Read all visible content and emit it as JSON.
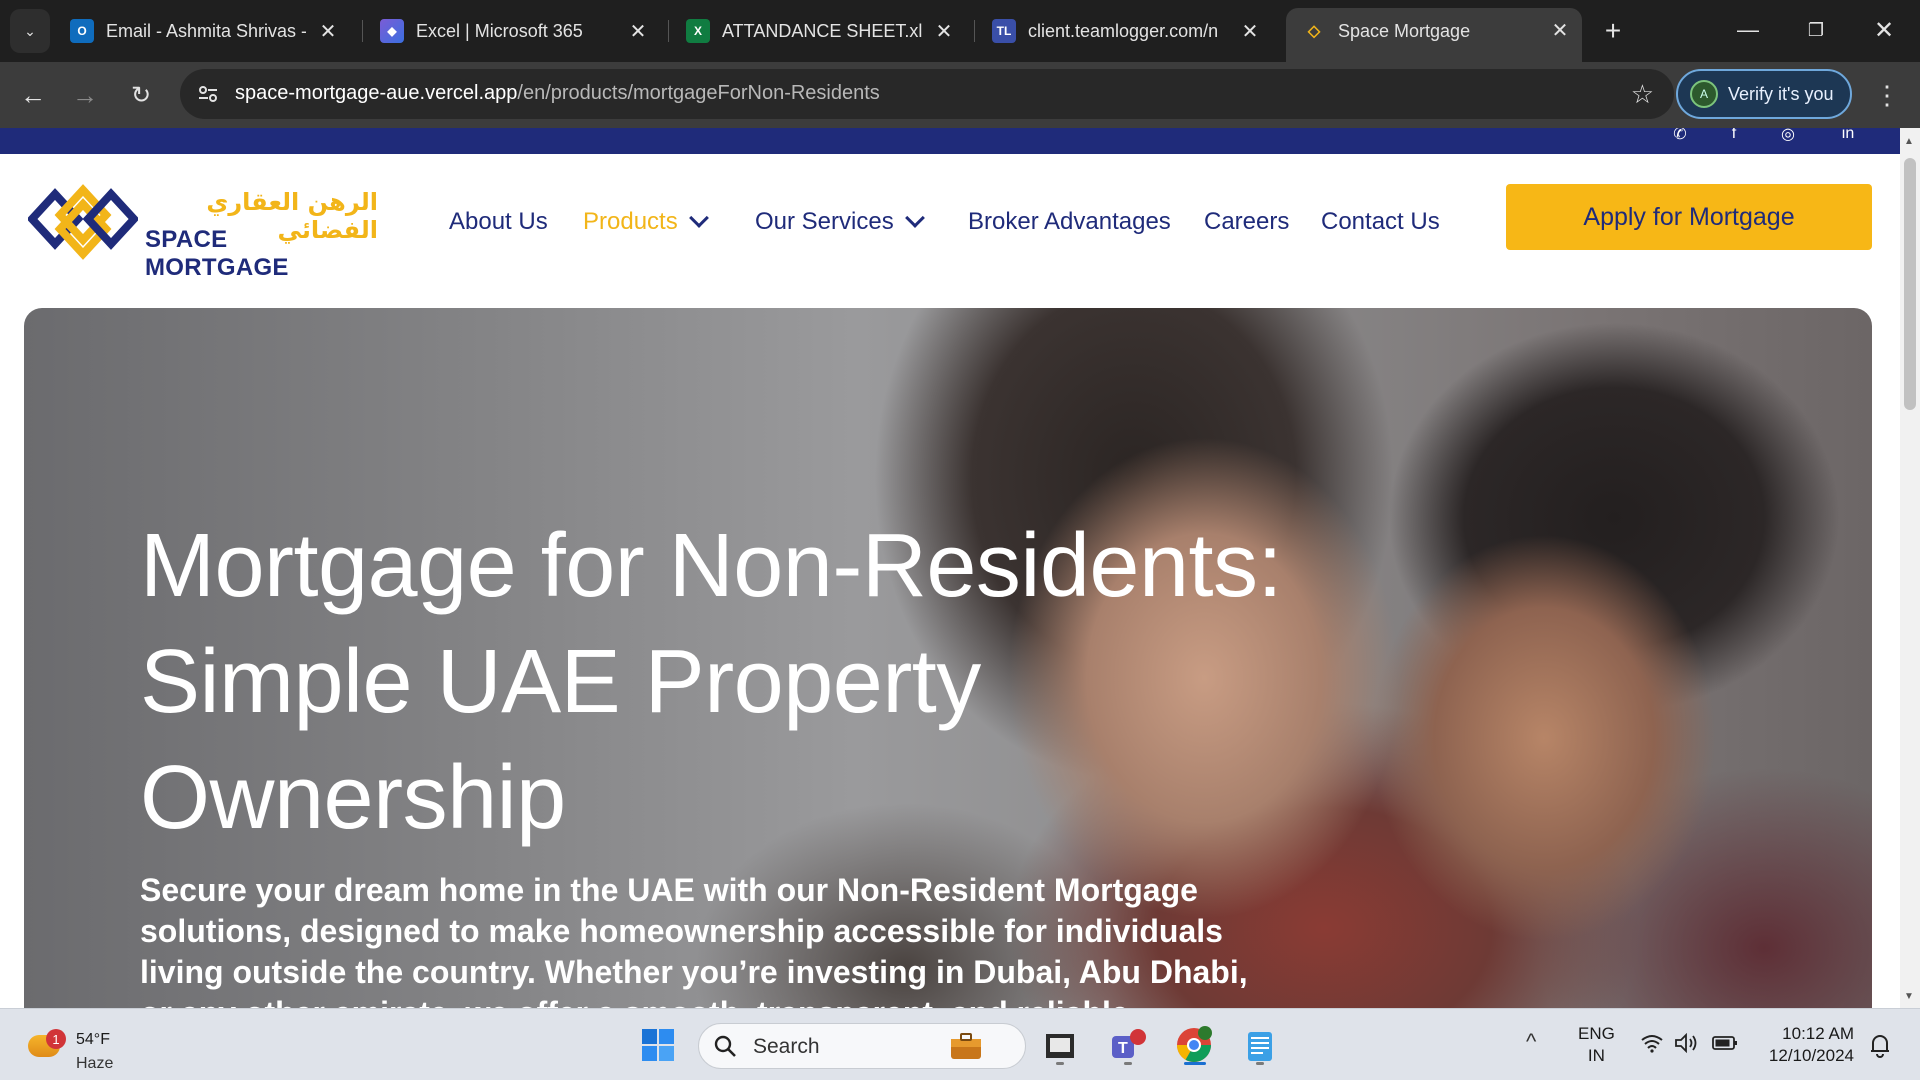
{
  "browser": {
    "tabs": [
      {
        "title": "Email - Ashmita Shrivas -",
        "icon": "outlook-icon",
        "active": false
      },
      {
        "title": "Excel | Microsoft 365",
        "icon": "m365-icon",
        "active": false
      },
      {
        "title": "ATTANDANCE SHEET.xlsx",
        "icon": "excel-icon",
        "active": false
      },
      {
        "title": "client.teamlogger.com/n",
        "icon": "teamlogger-icon",
        "active": false
      },
      {
        "title": "Space Mortgage",
        "icon": "space-mortgage-favicon",
        "active": true
      }
    ],
    "url_host": "space-mortgage-aue.vercel.app",
    "url_path": "/en/products/mortgageForNon-Residents",
    "verify_label": "Verify it's you",
    "profile_initial": "A"
  },
  "site": {
    "logo_arabic": "الرهن العقاري الفضائي",
    "logo_english": "SPACE MORTGAGE",
    "nav": [
      {
        "label": "About Us",
        "active": false,
        "dropdown": false
      },
      {
        "label": "Products",
        "active": true,
        "dropdown": true
      },
      {
        "label": "Our Services",
        "active": false,
        "dropdown": true
      },
      {
        "label": "Broker Advantages",
        "active": false,
        "dropdown": false
      },
      {
        "label": "Careers",
        "active": false,
        "dropdown": false
      },
      {
        "label": "Contact Us",
        "active": false,
        "dropdown": false
      }
    ],
    "cta_label": "Apply for Mortgage",
    "hero": {
      "title": "Mortgage for Non-Residents: Simple UAE Property Ownership",
      "subtitle": "Secure your dream home in the UAE with our Non-Resident Mortgage solutions, designed to make homeownership accessible for individuals living outside the country. Whether you’re investing in Dubai, Abu Dhabi, or any other emirate, we offer a smooth, transparent, and reliable"
    },
    "colors": {
      "brand_navy": "#1f2b7a",
      "brand_gold": "#f2b519",
      "cta_gold": "#f7b716"
    }
  },
  "taskbar": {
    "weather_temp": "54°F",
    "weather_condition": "Haze",
    "weather_badge": "1",
    "search_label": "Search",
    "lang_line1": "ENG",
    "lang_line2": "IN",
    "time": "10:12 AM",
    "date": "12/10/2024"
  }
}
